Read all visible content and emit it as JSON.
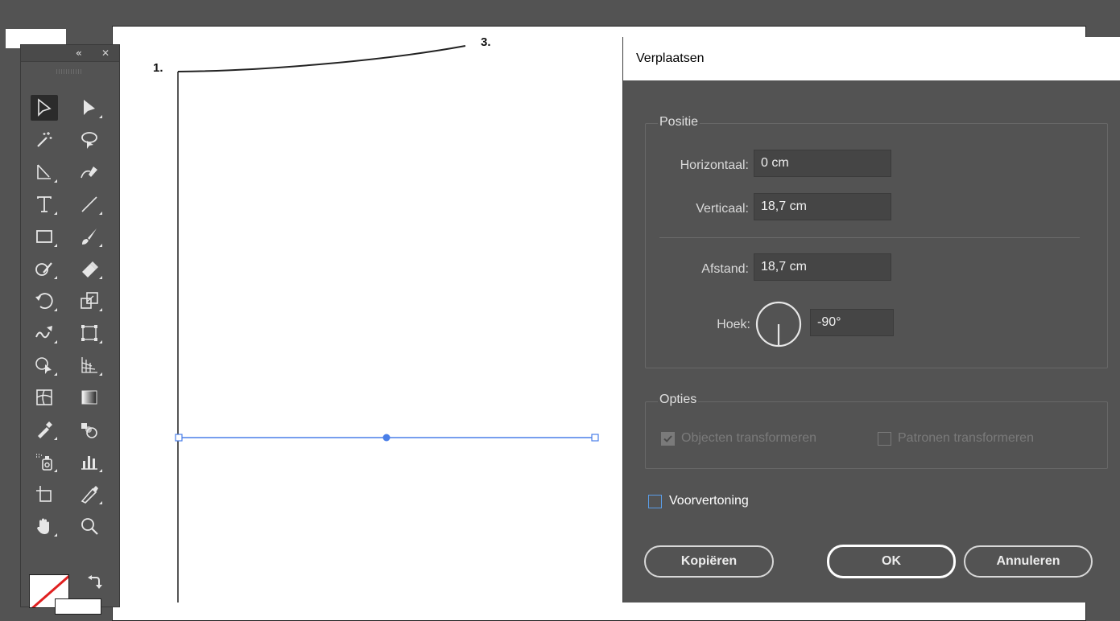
{
  "canvas": {
    "labels": {
      "point1": "1.",
      "point3": "3."
    }
  },
  "tools_panel": {
    "collapse_glyph": "«",
    "close_glyph": "✕",
    "tools": [
      {
        "name": "selection-tool-icon"
      },
      {
        "name": "direct-selection-tool-icon"
      },
      {
        "name": "magic-wand-tool-icon"
      },
      {
        "name": "lasso-tool-icon"
      },
      {
        "name": "anchor-point-tool-icon"
      },
      {
        "name": "curvature-pen-tool-icon"
      },
      {
        "name": "type-tool-icon"
      },
      {
        "name": "line-segment-tool-icon"
      },
      {
        "name": "rectangle-tool-icon"
      },
      {
        "name": "paintbrush-tool-icon"
      },
      {
        "name": "shaper-tool-icon"
      },
      {
        "name": "eraser-tool-icon"
      },
      {
        "name": "rotate-tool-icon"
      },
      {
        "name": "scale-tool-icon"
      },
      {
        "name": "warp-tool-icon"
      },
      {
        "name": "free-transform-tool-icon"
      },
      {
        "name": "shape-builder-tool-icon"
      },
      {
        "name": "perspective-grid-tool-icon"
      },
      {
        "name": "mesh-tool-icon"
      },
      {
        "name": "gradient-tool-icon"
      },
      {
        "name": "eyedropper-tool-icon"
      },
      {
        "name": "blend-tool-icon"
      },
      {
        "name": "symbol-sprayer-tool-icon"
      },
      {
        "name": "column-graph-tool-icon"
      },
      {
        "name": "artboard-tool-icon"
      },
      {
        "name": "slice-tool-icon"
      },
      {
        "name": "hand-tool-icon"
      },
      {
        "name": "zoom-tool-icon"
      }
    ]
  },
  "dialog": {
    "title": "Verplaatsen",
    "positie": {
      "legend": "Positie",
      "horizontaal_label": "Horizontaal:",
      "horizontaal_value": "0 cm",
      "verticaal_label": "Verticaal:",
      "verticaal_value": "18,7 cm",
      "afstand_label": "Afstand:",
      "afstand_value": "18,7 cm",
      "hoek_label": "Hoek:",
      "hoek_value": "-90°"
    },
    "opties": {
      "legend": "Opties",
      "objecten_label": "Objecten transformeren",
      "objecten_checked": true,
      "patronen_label": "Patronen transformeren",
      "patronen_checked": false,
      "disabled": true
    },
    "voorvertoning_label": "Voorvertoning",
    "voorvertoning_checked": false,
    "buttons": {
      "kopieren": "Kopiëren",
      "ok": "OK",
      "annuleren": "Annuleren"
    }
  },
  "colors": {
    "workspace": "#535353",
    "selection_blue": "#4a7fe8",
    "dialog_text": "#d9d9d9",
    "disabled_text": "#7a7a7a"
  }
}
